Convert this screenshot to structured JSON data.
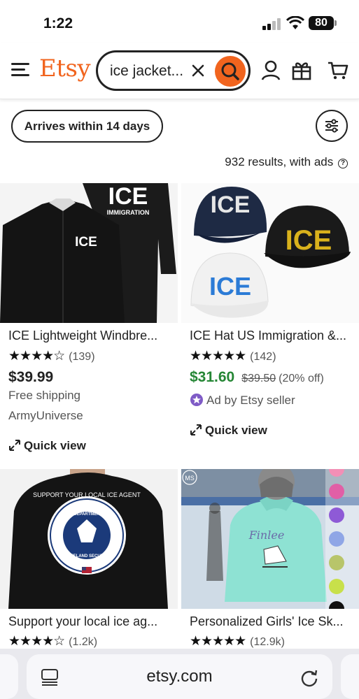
{
  "status_bar": {
    "time": "1:22",
    "battery": "80"
  },
  "header": {
    "logo": "Etsy",
    "search_query": "ice jacket...",
    "colors": {
      "brand": "#f1641e"
    }
  },
  "filters": {
    "delivery_pill": "Arrives within 14 days",
    "results_text": "932 results, with ads",
    "info_glyph": "?"
  },
  "products": [
    {
      "title": "ICE Lightweight Windbre...",
      "rating": 4.5,
      "stars": "★★★★☆",
      "review_count": "(139)",
      "price": "$39.99",
      "shipping": "Free shipping",
      "shop": "ArmyUniverse",
      "quick_view": "Quick view",
      "image_texts": [
        "ICE",
        "IMMIGRATION",
        "ICE"
      ]
    },
    {
      "title": "ICE Hat US Immigration &...",
      "rating": 5,
      "stars": "★★★★★",
      "review_count": "(142)",
      "price": "$31.60",
      "original_price": "$39.50",
      "discount": "(20% off)",
      "ad_label": "Ad by Etsy seller",
      "quick_view": "Quick view",
      "image_texts": [
        "ICE",
        "ICE",
        "ICE"
      ]
    },
    {
      "title": "Support your local ice ag...",
      "rating": 4.5,
      "stars": "★★★★☆",
      "review_count": "(1.2k)",
      "image_texts": [
        "SUPPORT YOUR LOCAL ICE AGENT",
        "U.S. DEPARTMENT OF",
        "HOMELAND SECURITY"
      ]
    },
    {
      "title": "Personalized Girls' Ice Sk...",
      "rating": 5,
      "stars": "★★★★★",
      "review_count": "(12.9k)",
      "image_texts": [
        "MS",
        "Finlee"
      ]
    }
  ],
  "browser": {
    "url": "etsy.com"
  }
}
